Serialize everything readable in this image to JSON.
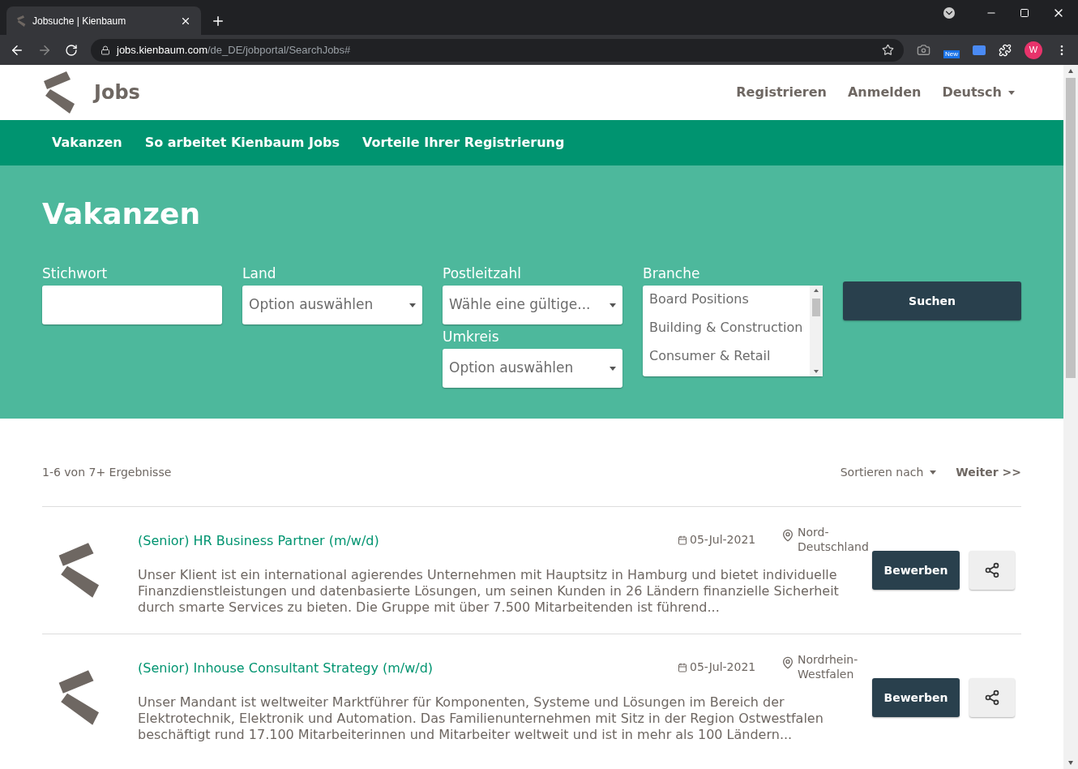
{
  "browser": {
    "tab_title": "Jobsuche | Kienbaum",
    "url_host": "jobs.kienbaum.com",
    "url_path": "/de_DE/jobportal/SearchJobs#",
    "profile_initial": "W",
    "extension_badge": "New"
  },
  "header": {
    "brand": "Jobs",
    "links": [
      "Registrieren",
      "Anmelden"
    ],
    "language": "Deutsch"
  },
  "nav": [
    "Vakanzen",
    "So arbeitet Kienbaum Jobs",
    "Vorteile Ihrer Registrierung"
  ],
  "hero": {
    "title": "Vakanzen",
    "keyword": {
      "label": "Stichwort"
    },
    "country": {
      "label": "Land",
      "value": "Option auswählen"
    },
    "postcode": {
      "label": "Postleitzahl",
      "value": "Wähle eine gültige..."
    },
    "radius": {
      "label": "Umkreis",
      "value": "Option auswählen"
    },
    "industry": {
      "label": "Branche",
      "options": [
        "Board Positions",
        "Building & Construction",
        "Consumer & Retail"
      ]
    },
    "search_button": "Suchen"
  },
  "results": {
    "count": "1-6 von 7+ Ergebnisse",
    "sort": "Sortieren nach",
    "next": "Weiter >>"
  },
  "jobs": [
    {
      "title": "(Senior) HR Business Partner (m/w/d)",
      "date": "05-Jul-2021",
      "location": "Nord-\nDeutschland",
      "description": "Unser Klient ist ein international agierendes Unternehmen mit Hauptsitz in Hamburg und bietet individuelle Finanzdienstleistungen und datenbasierte Lösungen, um seinen Kunden in 26 Ländern finanzielle Sicherheit durch smarte Services zu bieten. Die Gruppe mit über 7.500 Mitarbeitenden ist führend...",
      "apply": "Bewerben"
    },
    {
      "title": "(Senior) Inhouse Consultant Strategy (m/w/d)",
      "date": "05-Jul-2021",
      "location": "Nordrhein-\nWestfalen",
      "description": "Unser Mandant ist weltweiter Marktführer für Komponenten, Systeme und Lösungen im Bereich der Elektrotechnik, Elektronik und Automation. Das Familienunternehmen mit Sitz in der Region Ostwestfalen beschäftigt rund 17.100 Mitarbeiterinnen und Mitarbeiter weltweit und ist in mehr als 100 Ländern...",
      "apply": "Bewerben"
    }
  ]
}
